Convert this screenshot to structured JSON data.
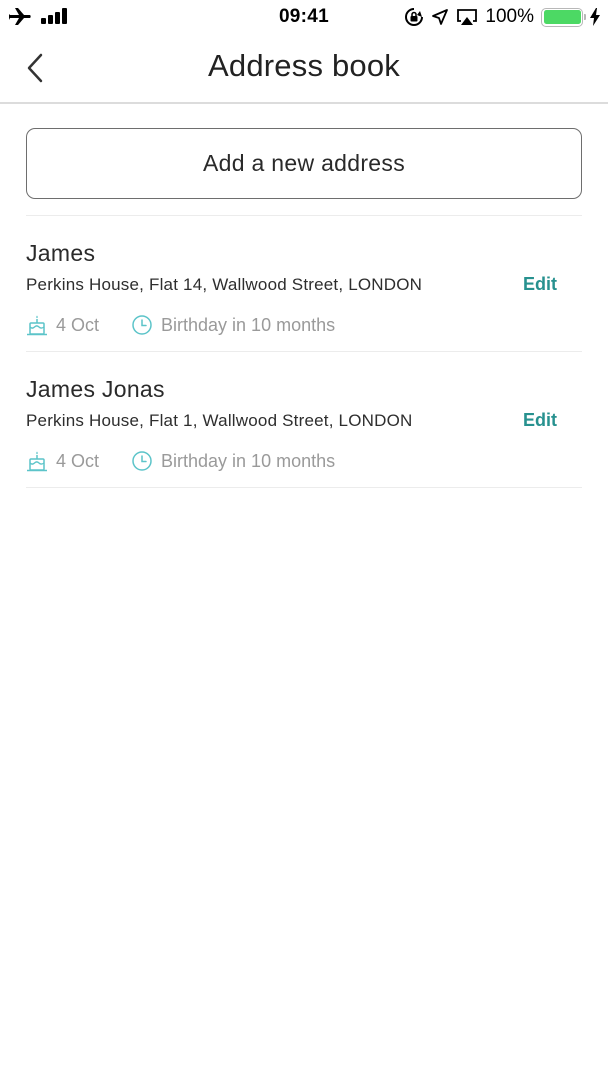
{
  "status_bar": {
    "time": "09:41",
    "battery_percent": "100%",
    "battery_level": 1.0,
    "icons": [
      "airplane-mode-icon",
      "signal-bars-icon",
      "orientation-lock-icon",
      "location-arrow-icon",
      "airplay-icon",
      "battery-icon",
      "charging-bolt-icon"
    ]
  },
  "nav": {
    "title": "Address book",
    "back_icon": "chevron-left-icon"
  },
  "add_button": {
    "label": "Add a new address"
  },
  "colors": {
    "accent": "#27918f",
    "icon_teal": "#5cc4c9",
    "muted_text": "#9a9a9a",
    "battery_green": "#4cd964"
  },
  "entries": [
    {
      "name": "James",
      "address": "Perkins House, Flat 14, Wallwood Street, LONDON",
      "edit_label": "Edit",
      "birthday_date": "4 Oct",
      "birthday_countdown": "Birthday in 10 months"
    },
    {
      "name": "James Jonas",
      "address": "Perkins House, Flat 1, Wallwood Street, LONDON",
      "edit_label": "Edit",
      "birthday_date": "4 Oct",
      "birthday_countdown": "Birthday in 10 months"
    }
  ]
}
